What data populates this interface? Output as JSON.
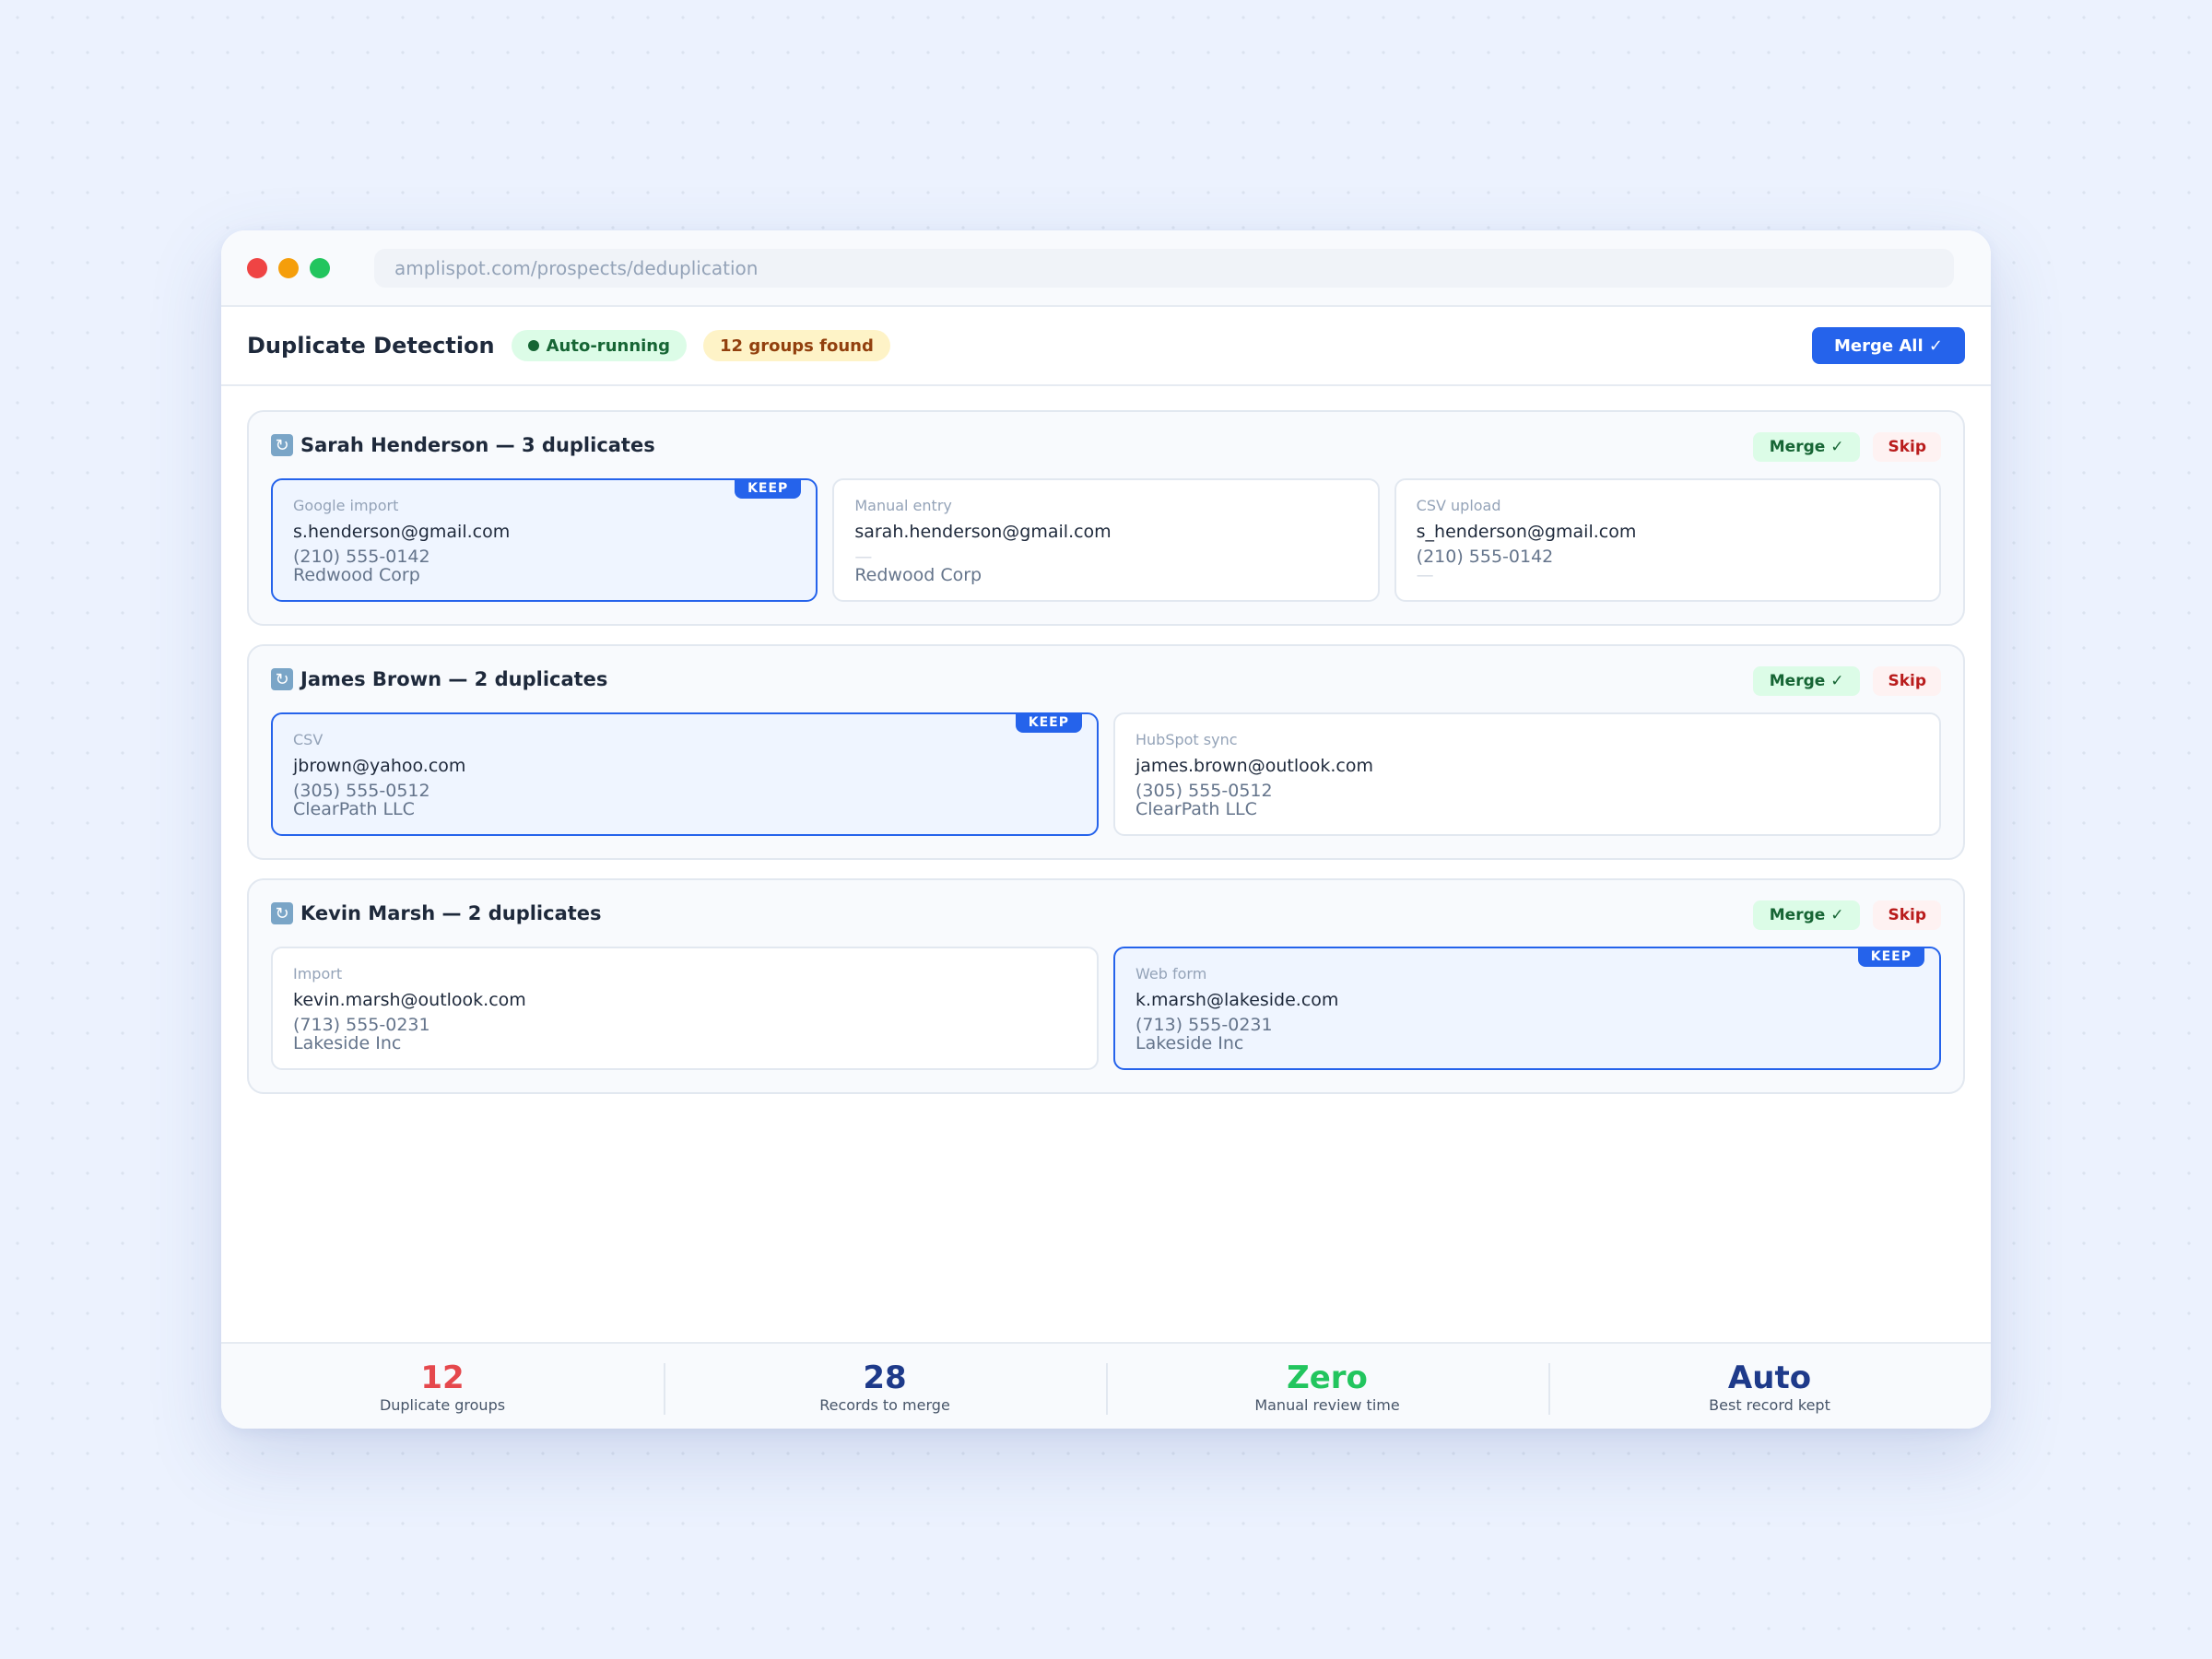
{
  "browser": {
    "url": "amplispot.com/prospects/deduplication"
  },
  "header": {
    "title": "Duplicate Detection",
    "status_pill": "Auto-running",
    "count_pill": "12 groups found",
    "merge_all_label": "Merge All ✓"
  },
  "group_actions": {
    "merge_label": "Merge ✓",
    "skip_label": "Skip"
  },
  "keep_label": "KEEP",
  "groups": [
    {
      "icon": "refresh-icon",
      "title": "Sarah Henderson — 3 duplicates",
      "records": [
        {
          "source": "Google import",
          "email": "s.henderson@gmail.com",
          "phone": "(210) 555-0142",
          "company": "Redwood Corp",
          "keep": true
        },
        {
          "source": "Manual entry",
          "email": "sarah.henderson@gmail.com",
          "phone": "—",
          "company": "Redwood Corp",
          "keep": false
        },
        {
          "source": "CSV upload",
          "email": "s_henderson@gmail.com",
          "phone": "(210) 555-0142",
          "company": "—",
          "keep": false
        }
      ]
    },
    {
      "icon": "refresh-icon",
      "title": "James Brown — 2 duplicates",
      "records": [
        {
          "source": "CSV",
          "email": "jbrown@yahoo.com",
          "phone": "(305) 555-0512",
          "company": "ClearPath LLC",
          "keep": true
        },
        {
          "source": "HubSpot sync",
          "email": "james.brown@outlook.com",
          "phone": "(305) 555-0512",
          "company": "ClearPath LLC",
          "keep": false
        }
      ]
    },
    {
      "icon": "refresh-icon",
      "title": "Kevin Marsh — 2 duplicates",
      "records": [
        {
          "source": "Import",
          "email": "kevin.marsh@outlook.com",
          "phone": "(713) 555-0231",
          "company": "Lakeside Inc",
          "keep": false
        },
        {
          "source": "Web form",
          "email": "k.marsh@lakeside.com",
          "phone": "(713) 555-0231",
          "company": "Lakeside Inc",
          "keep": true
        }
      ]
    }
  ],
  "stats": [
    {
      "value": "12",
      "label": "Duplicate groups",
      "color": "#e5484d"
    },
    {
      "value": "28",
      "label": "Records to merge",
      "color": "#1e3a8a"
    },
    {
      "value": "Zero",
      "label": "Manual review time",
      "color": "#22c55e"
    },
    {
      "value": "Auto",
      "label": "Best record kept",
      "color": "#1e3a8a"
    }
  ]
}
